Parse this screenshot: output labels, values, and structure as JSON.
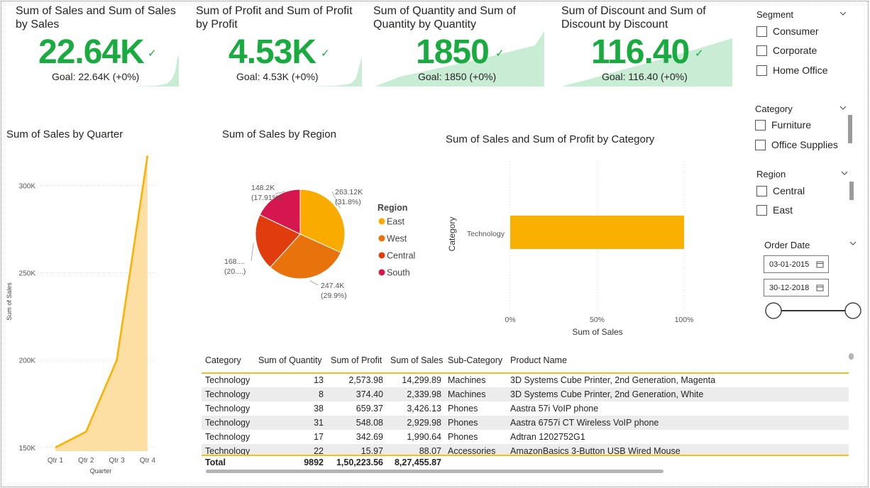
{
  "kpis": [
    {
      "title_line1": "Sum of Sales and Sum of Sales",
      "title_line2": "by Sales",
      "value": "22.64K",
      "goal": "Goal: 22.64K (+0%)"
    },
    {
      "title_line1": "Sum of Profit and Sum of Profit",
      "title_line2": "by Profit",
      "value": "4.53K",
      "goal": "Goal: 4.53K (+0%)"
    },
    {
      "title_line1": "Sum of Quantity and Sum of",
      "title_line2": "Quantity by Quantity",
      "value": "1850",
      "goal": "Goal: 1850 (+0%)"
    },
    {
      "title_line1": "Sum of Discount and Sum of",
      "title_line2": "Discount by Discount",
      "value": "116.40",
      "goal": "Goal: 116.40 (+0%)"
    }
  ],
  "colors": {
    "kpi_green": "#1aab40",
    "spark_fill": "#c9ecd4",
    "area_fill": "#fddc9a",
    "area_line": "#f9b000",
    "bar": "#f9b000",
    "table_accent": "#f0c020"
  },
  "slicers": {
    "segment": {
      "title": "Segment",
      "items": [
        "Consumer",
        "Corporate",
        "Home Office"
      ]
    },
    "category": {
      "title": "Category",
      "items": [
        "Furniture",
        "Office Supplies"
      ]
    },
    "region": {
      "title": "Region",
      "items": [
        "Central",
        "East"
      ]
    },
    "order_date": {
      "title": "Order Date",
      "start": "03-01-2015",
      "end": "30-12-2018"
    }
  },
  "chart_data": [
    {
      "type": "area",
      "title": "Sum of Sales by Quarter",
      "xlabel": "Quarter",
      "ylabel": "Sum of Sales",
      "categories": [
        "Qtr 1",
        "Qtr 2",
        "Qtr 3",
        "Qtr 4"
      ],
      "values": [
        150000,
        159000,
        200000,
        317000
      ],
      "yticks": [
        150000,
        200000,
        250000,
        300000
      ],
      "ytick_labels": [
        "150K",
        "200K",
        "250K",
        "300K"
      ],
      "ylim": [
        141000,
        318000
      ],
      "grid": true
    },
    {
      "type": "pie",
      "title": "Sum of Sales by Region",
      "legend_title": "Region",
      "legend_position": "right",
      "slices": [
        {
          "name": "East",
          "value": 263.12,
          "label": "263.12K",
          "pct_label": "(31.8%)",
          "color": "#f9ab00"
        },
        {
          "name": "West",
          "value": 247.4,
          "label": "247.4K",
          "pct_label": "(29.9%)",
          "color": "#e8720c"
        },
        {
          "name": "Central",
          "value": 168.8,
          "label": "168....",
          "pct_label": "(20....)",
          "color": "#e03c0e"
        },
        {
          "name": "South",
          "value": 148.2,
          "label": "148.2K",
          "pct_label": "(17.91%)",
          "color": "#d6164f"
        }
      ]
    },
    {
      "type": "bar",
      "title": "Sum of Sales and Sum of Profit by Category",
      "xlabel": "Sum of Sales",
      "ylabel": "Category",
      "categories": [
        "Technology"
      ],
      "values": [
        1.0
      ],
      "xticks": [
        "0%",
        "50%",
        "100%"
      ],
      "xlim": [
        0,
        1
      ]
    }
  ],
  "table": {
    "headers": [
      "Category",
      "Sum of Quantity",
      "Sum of Profit",
      "Sum of Sales",
      "Sub-Category",
      "Product Name"
    ],
    "rows": [
      [
        "Technology",
        "13",
        "2,573.98",
        "14,299.89",
        "Machines",
        "3D Systems Cube Printer, 2nd Generation, Magenta"
      ],
      [
        "Technology",
        "8",
        "374.40",
        "2,339.98",
        "Machines",
        "3D Systems Cube Printer, 2nd Generation, White"
      ],
      [
        "Technology",
        "38",
        "659.37",
        "3,426.13",
        "Phones",
        "Aastra 57i VoIP phone"
      ],
      [
        "Technology",
        "31",
        "548.08",
        "2,929.98",
        "Phones",
        "Aastra 6757i CT Wireless VoIP phone"
      ],
      [
        "Technology",
        "17",
        "342.69",
        "1,990.64",
        "Phones",
        "Adtran 1202752G1"
      ],
      [
        "Technology",
        "22",
        "15.97",
        "88.07",
        "Accessories",
        "AmazonBasics 3-Button USB Wired Mouse"
      ]
    ],
    "total": {
      "label": "Total",
      "quantity": "9892",
      "profit": "1,50,223.56",
      "sales": "8,27,455.87"
    }
  }
}
